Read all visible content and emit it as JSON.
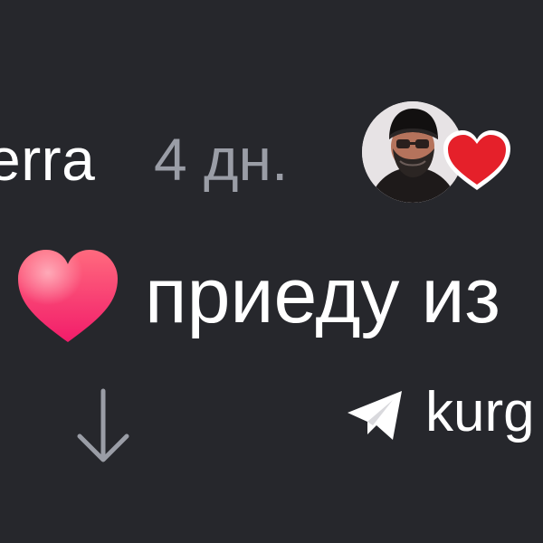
{
  "comment": {
    "author": "erra",
    "time_ago": "4 дн.",
    "text": "приеду из",
    "emoji_name": "heart-emoji",
    "author_avatar_reaction": "heart-icon"
  },
  "footer": {
    "expand_icon": "arrow-down-icon",
    "channel_icon": "telegram-icon",
    "channel_label": "kurg"
  },
  "colors": {
    "background": "#26272c",
    "primary_text": "#ffffff",
    "secondary_text": "#9a9da6",
    "reaction_heart": "#e5202a",
    "emoji_heart_top": "#ff6a7e",
    "emoji_heart_bottom": "#f21c6a"
  }
}
